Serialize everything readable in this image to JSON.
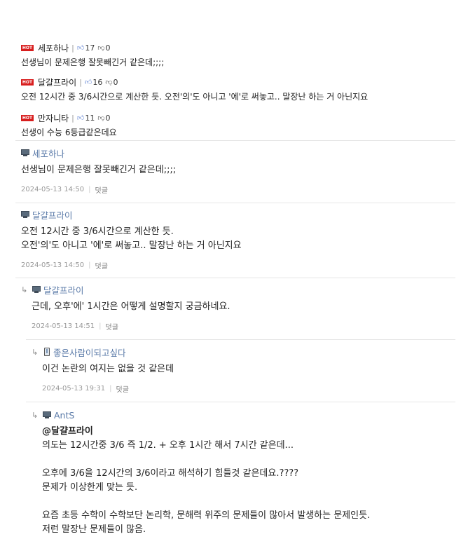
{
  "best_comments": [
    {
      "badge": "HOT",
      "nick": "세포하나",
      "up": "17",
      "down": "0",
      "text": "선생님이 문제은행 잘못빼긴거 같은데;;;;"
    },
    {
      "badge": "HOT",
      "nick": "달걀프라이",
      "up": "16",
      "down": "0",
      "text": "오전 12시간 중 3/6시간으로 계산한 듯. 오전'의'도 아니고 '에'로 써놓고.. 말장난 하는 거 아닌지요"
    },
    {
      "badge": "HOT",
      "nick": "만자니타",
      "up": "11",
      "down": "0",
      "text": "선생이 수능 6등급같은데요"
    }
  ],
  "comments": [
    {
      "nick": "세포하나",
      "text": "선생님이 문제은행 잘못빼긴거 같은데;;;;",
      "date": "2024-05-13 14:50",
      "reply_label": "덧글"
    },
    {
      "nick": "달걀프라이",
      "text": "오전 12시간 중 3/6시간으로 계산한 듯.\n오전'의'도 아니고 '에'로 써놓고.. 말장난 하는 거 아닌지요",
      "date": "2024-05-13 14:50",
      "reply_label": "덧글"
    },
    {
      "nick": "달걀프라이",
      "text": "근데, 오후'에' 1시간은 어떻게 설명할지 궁금하네요.",
      "date": "2024-05-13 14:51",
      "reply_label": "덧글"
    },
    {
      "nick": "좋은사람이되고싶다",
      "text": "이건 논란의 여지는 없을 것 같은데",
      "date": "2024-05-13 19:31",
      "reply_label": "덧글"
    },
    {
      "nick": "AntS",
      "mention": "@달걀프라이",
      "text": "의도는 12시간중 3/6 즉 1/2. + 오후 1시간 해서 7시간 같은데...\n\n오후에 3/6을 12시간의 3/6이라고 해석하기 힘들것 같은데요.????\n문제가 이상한게 맞는 듯.\n\n요즘 초등 수학이 수학보단 논리학, 문해력 위주의 문제들이 많아서 발생하는 문제인듯.\n저런 말장난 문제들이 많음."
    }
  ],
  "icons": {
    "pc": "pc-monitor-icon",
    "mobile": "mobile-phone-icon",
    "reply_arrow": "reply-arrow-icon",
    "thumb_up": "thumb-up-icon",
    "thumb_down": "thumb-down-icon"
  },
  "colors": {
    "hot_badge": "#d81e1e",
    "nick": "#5a7aa8",
    "thumb_up": "#5b7fd1"
  }
}
